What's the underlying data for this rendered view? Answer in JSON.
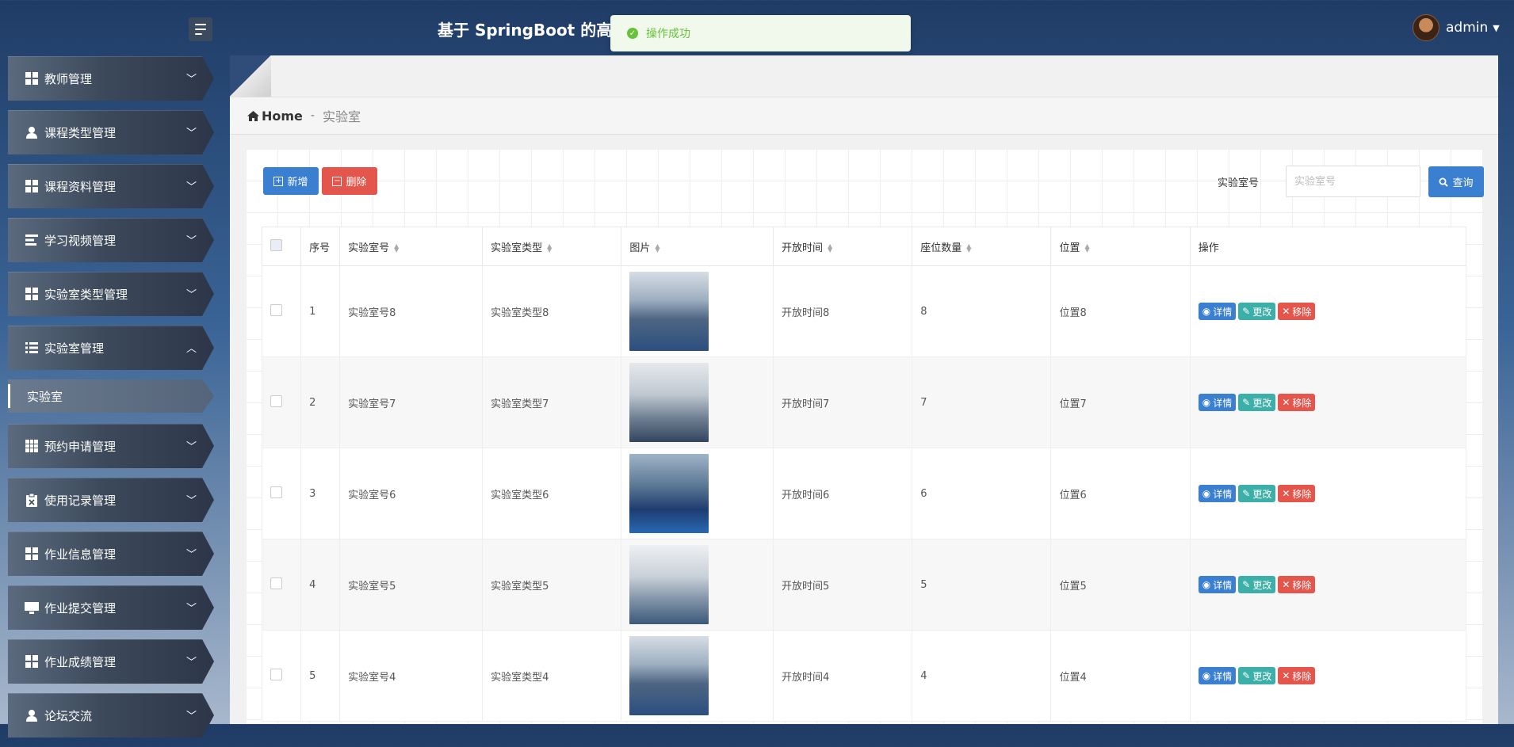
{
  "app": {
    "title": "基于 SpringBoot 的高校",
    "user": "admin"
  },
  "toast": {
    "message": "操作成功"
  },
  "sidebar": {
    "items": [
      {
        "label": "教师管理",
        "icon": "grid-icon"
      },
      {
        "label": "课程类型管理",
        "icon": "user-icon"
      },
      {
        "label": "课程资料管理",
        "icon": "grid-icon"
      },
      {
        "label": "学习视频管理",
        "icon": "bars-icon"
      },
      {
        "label": "实验室类型管理",
        "icon": "grid-icon"
      },
      {
        "label": "实验室管理",
        "icon": "list-icon",
        "expanded": true
      },
      {
        "label": "预约申请管理",
        "icon": "grid9-icon"
      },
      {
        "label": "使用记录管理",
        "icon": "clipboard-icon"
      },
      {
        "label": "作业信息管理",
        "icon": "grid-icon"
      },
      {
        "label": "作业提交管理",
        "icon": "monitor-icon"
      },
      {
        "label": "作业成绩管理",
        "icon": "grid-icon"
      },
      {
        "label": "论坛交流",
        "icon": "user-icon"
      }
    ],
    "sub_item": "实验室"
  },
  "breadcrumb": {
    "home": "Home",
    "separator": "-",
    "current": "实验室"
  },
  "toolbar": {
    "add_label": "新增",
    "delete_label": "删除",
    "search_label": "实验室号",
    "search_placeholder": "实验室号",
    "search_value": "",
    "query_label": "查询"
  },
  "table": {
    "headers": [
      "序号",
      "实验室号",
      "实验室类型",
      "图片",
      "开放时间",
      "座位数量",
      "位置",
      "操作"
    ],
    "rows": [
      {
        "no": "1",
        "lab_no": "实验室号8",
        "lab_type": "实验室类型8",
        "open_time": "开放时间8",
        "seats": "8",
        "location": "位置8"
      },
      {
        "no": "2",
        "lab_no": "实验室号7",
        "lab_type": "实验室类型7",
        "open_time": "开放时间7",
        "seats": "7",
        "location": "位置7"
      },
      {
        "no": "3",
        "lab_no": "实验室号6",
        "lab_type": "实验室类型6",
        "open_time": "开放时间6",
        "seats": "6",
        "location": "位置6"
      },
      {
        "no": "4",
        "lab_no": "实验室号5",
        "lab_type": "实验室类型5",
        "open_time": "开放时间5",
        "seats": "5",
        "location": "位置5"
      },
      {
        "no": "5",
        "lab_no": "实验室号4",
        "lab_type": "实验室类型4",
        "open_time": "开放时间4",
        "seats": "4",
        "location": "位置4"
      }
    ],
    "actions": {
      "detail": "详情",
      "edit": "更改",
      "remove": "移除"
    }
  },
  "colors": {
    "primary": "#3a7fd0",
    "danger": "#e4554c",
    "info": "#3cb0a8",
    "success": "#67c23a"
  }
}
